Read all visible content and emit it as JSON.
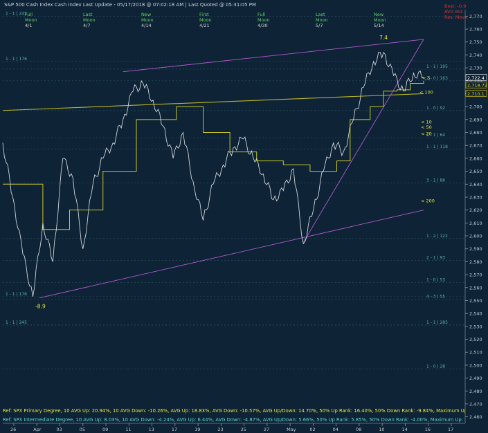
{
  "header": {
    "title": "S&P 500 Cash Index  Cash Index  Last Update - 05/17/2018 @ 07:02:18 AM | Last Quoted @ 05:31:05 PM"
  },
  "top_legend": {
    "item1": "Best: -0.9",
    "item2": "AVG Bid",
    "item3": "Res. Move"
  },
  "moon_phases": [
    {
      "phase": "Full",
      "sub": "Moon",
      "date": "4/1"
    },
    {
      "phase": "Last",
      "sub": "Moon",
      "date": "4/7"
    },
    {
      "phase": "New",
      "sub": "Moon",
      "date": "4/14"
    },
    {
      "phase": "First",
      "sub": "Moon",
      "date": "4/21"
    },
    {
      "phase": "Full",
      "sub": "Moon",
      "date": "4/30"
    },
    {
      "phase": "Last",
      "sub": "Moon",
      "date": "5/7"
    },
    {
      "phase": "New",
      "sub": "Moon",
      "date": "5/14"
    }
  ],
  "ref_lines": {
    "primary": "Ref: SPX Primary Degree, 10 AVG Up: 20.94%, 10 AVG Down: -10.26%, AVG Up: 18.83%, AVG Down: -10.57%, AVG Up/Down: 14.70%, 50%  Up Rank: 16.40%, 50% Down Rank: -9.84%, Maximum Up: 58.71%, Maximum",
    "intermediate": "Ref: SPX Intermediate Degree, 10 AVG Up: 8.03%, 10 AVG Down: -4.24%, AVG Up: 6.44%, AVG Down: -4.87%, AVG Up/Down: 5.66%, 50%  Up Rank: 5.85%, 50% Down Rank: -4.00%, Maximum Up: 20.27%, Maximum Do"
  },
  "chart_data": {
    "type": "line",
    "title": "S&P 500 Cash Index",
    "ylim": [
      2455,
      2775
    ],
    "y_ticks": [
      2460,
      2470,
      2480,
      2490,
      2500,
      2510,
      2520,
      2530,
      2540,
      2550,
      2560,
      2570,
      2580,
      2590,
      2600,
      2610,
      2620,
      2630,
      2640,
      2650,
      2660,
      2670,
      2680,
      2690,
      2700,
      2710,
      2720,
      2730,
      2740,
      2750,
      2760,
      2770
    ],
    "x_tick_labels": [
      "26",
      "Apr",
      "03",
      "05",
      "09",
      "11",
      "13",
      "17",
      "19",
      "23",
      "25",
      "27",
      "May",
      "02",
      "04",
      "08",
      "10",
      "14",
      "16",
      "17"
    ],
    "price_series": {
      "name": "SPX",
      "x": [
        0,
        3,
        6,
        9,
        12,
        15,
        18,
        21,
        24,
        27,
        30,
        33,
        36,
        39,
        42,
        45,
        48,
        51,
        54,
        57,
        60,
        63,
        66,
        69,
        72,
        75,
        78,
        81,
        84,
        87,
        90,
        93,
        96,
        99,
        102,
        105,
        108,
        111,
        114,
        117,
        120,
        123,
        126
      ],
      "y": [
        2672,
        2630,
        2586,
        2553,
        2610,
        2580,
        2660,
        2645,
        2590,
        2640,
        2660,
        2672,
        2690,
        2712,
        2718,
        2705,
        2685,
        2660,
        2680,
        2642,
        2612,
        2640,
        2655,
        2668,
        2675,
        2660,
        2648,
        2628,
        2635,
        2652,
        2594,
        2620,
        2650,
        2672,
        2665,
        2690,
        2715,
        2735,
        2742,
        2724,
        2712,
        2726,
        2723
      ]
    },
    "moving_averages": [
      {
        "name": "5",
        "value": 2718.72
      },
      {
        "name": "100",
        "value": 2710.1
      },
      {
        "name": "10",
        "value": 2690
      },
      {
        "name": "50",
        "value": 2685
      },
      {
        "name": "20",
        "value": 2680
      },
      {
        "name": "200",
        "value": 2635
      }
    ],
    "ma_step_series": {
      "x": [
        0,
        12,
        20,
        30,
        40,
        52,
        60,
        68,
        76,
        84,
        92,
        100,
        104,
        110,
        114,
        118,
        122,
        126
      ],
      "y": [
        2640,
        2605,
        2620,
        2650,
        2690,
        2700,
        2680,
        2665,
        2658,
        2655,
        2650,
        2658,
        2690,
        2700,
        2712,
        2713,
        2718,
        2720
      ]
    },
    "ma200_series": {
      "x": [
        0,
        126
      ],
      "y": [
        2697,
        2710
      ]
    },
    "channel_lines": [
      {
        "name": "upper",
        "x": [
          36,
          126
        ],
        "y": [
          2727,
          2752
        ]
      },
      {
        "name": "lower",
        "x": [
          11,
          126
        ],
        "y": [
          2552,
          2620
        ]
      },
      {
        "name": "support",
        "x": [
          90,
          126
        ],
        "y": [
          2595,
          2752
        ]
      }
    ],
    "horizontal_levels": [
      {
        "label": "1 - 1 | 245",
        "value": 2770
      },
      {
        "label": "1 - 1 | 176",
        "value": 2735
      },
      {
        "label": "1 - 1 | 195",
        "value": 2729
      },
      {
        "label": "2 - 0 | 163",
        "value": 2720
      },
      {
        "label": "1 - 0 | 92",
        "value": 2697
      },
      {
        "label": "1 - 1 | 64",
        "value": 2676
      },
      {
        "label": "1 - 1 | 118",
        "value": 2667
      },
      {
        "label": "3 - 1 | 86",
        "value": 2641
      },
      {
        "label": "1 - 2 | 122",
        "value": 2598
      },
      {
        "label": "2 - 1 | 93",
        "value": 2581
      },
      {
        "label": "1 - 0 | 53",
        "value": 2564
      },
      {
        "label": "1 - 1 | 176",
        "value": 2553
      },
      {
        "label": "4 - 3 | 55",
        "value": 2551
      },
      {
        "label": "1 - 1 | 245",
        "value": 2531
      },
      {
        "label": "1 - 1 | 285",
        "value": 2531
      },
      {
        "label": "1 - 0 | 28",
        "value": 2497
      }
    ],
    "price_tags": [
      {
        "label": "2,722.4",
        "value": 2722.4
      },
      {
        "label": "2,718.72",
        "value": 2718.72
      },
      {
        "label": "2,710.1",
        "value": 2710.1
      }
    ],
    "annotations": [
      {
        "text": "-8.9",
        "x": 11,
        "y": 2544
      },
      {
        "text": "7.4",
        "x": 114,
        "y": 2752
      }
    ]
  }
}
